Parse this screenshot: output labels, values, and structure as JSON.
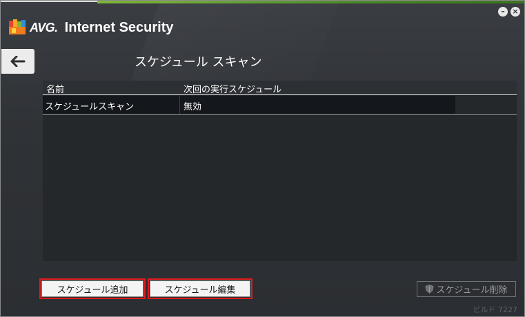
{
  "window": {
    "brand": "AVG.",
    "product": "Internet Security",
    "minimize_label": "–",
    "close_label": "×"
  },
  "page": {
    "title": "スケジュール スキャン"
  },
  "table": {
    "columns": [
      "名前",
      "次回の実行スケジュール"
    ],
    "rows": [
      {
        "name": "スケジュールスキャン",
        "next_run": "無効"
      }
    ]
  },
  "buttons": {
    "add": "スケジュール追加",
    "edit": "スケジュール編集",
    "delete": "スケジュール削除"
  },
  "footer": {
    "build": "ビルド 7227"
  },
  "colors": {
    "accent_green": "#4c8a28",
    "highlight_red": "#e01b1b",
    "background": "#2f3236"
  },
  "icons": {
    "back": "arrow-left-icon",
    "delete": "shield-icon",
    "logo": "avg-logo-icon"
  }
}
